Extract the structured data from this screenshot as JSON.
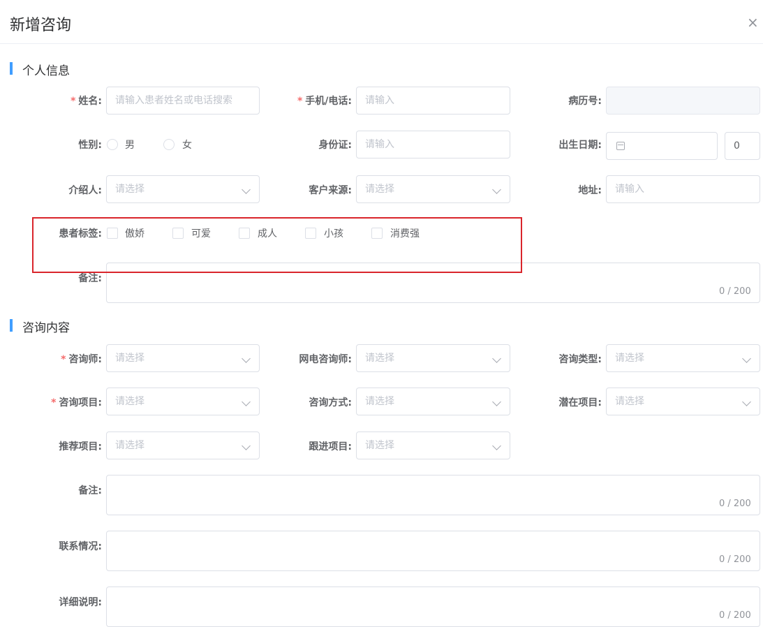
{
  "dialog": {
    "title": "新增咨询",
    "close_glyph": "×"
  },
  "personal": {
    "section_title": "个人信息",
    "name": {
      "required": "*",
      "label": "姓名:",
      "placeholder": "请输入患者姓名或电话搜索"
    },
    "phone": {
      "required": "*",
      "label": "手机/电话:",
      "placeholder": "请输入"
    },
    "record_no": {
      "label": "病历号:"
    },
    "gender": {
      "label": "性别:",
      "options": [
        "男",
        "女"
      ]
    },
    "id_card": {
      "label": "身份证:",
      "placeholder": "请输入"
    },
    "birth": {
      "label": "出生日期:",
      "age": "0"
    },
    "referrer": {
      "label": "介绍人:",
      "placeholder": "请选择"
    },
    "source": {
      "label": "客户来源:",
      "placeholder": "请选择"
    },
    "address": {
      "label": "地址:",
      "placeholder": "请输入"
    },
    "tags": {
      "label": "患者标签:",
      "options": [
        "傲娇",
        "可爱",
        "成人",
        "小孩",
        "消费强"
      ]
    },
    "remark": {
      "label": "备注:",
      "counter": "0 / 200"
    }
  },
  "consult": {
    "section_title": "咨询内容",
    "consultant": {
      "required": "*",
      "label": "咨询师:",
      "placeholder": "请选择"
    },
    "online_consultant": {
      "label": "网电咨询师:",
      "placeholder": "请选择"
    },
    "consult_type": {
      "label": "咨询类型:",
      "placeholder": "请选择"
    },
    "project": {
      "required": "*",
      "label": "咨询项目:",
      "placeholder": "请选择"
    },
    "method": {
      "label": "咨询方式:",
      "placeholder": "请选择"
    },
    "potential": {
      "label": "潜在项目:",
      "placeholder": "请选择"
    },
    "recommend": {
      "label": "推荐项目:",
      "placeholder": "请选择"
    },
    "follow": {
      "label": "跟进项目:",
      "placeholder": "请选择"
    },
    "remark": {
      "label": "备注:",
      "counter": "0 / 200"
    },
    "contact": {
      "label": "联系情况:",
      "counter": "0 / 200"
    },
    "detail": {
      "label": "详细说明:",
      "counter": "0 / 200"
    }
  },
  "colors": {
    "accent": "#409eff",
    "required": "#f56c6c",
    "highlight_box": "#d9252b"
  }
}
